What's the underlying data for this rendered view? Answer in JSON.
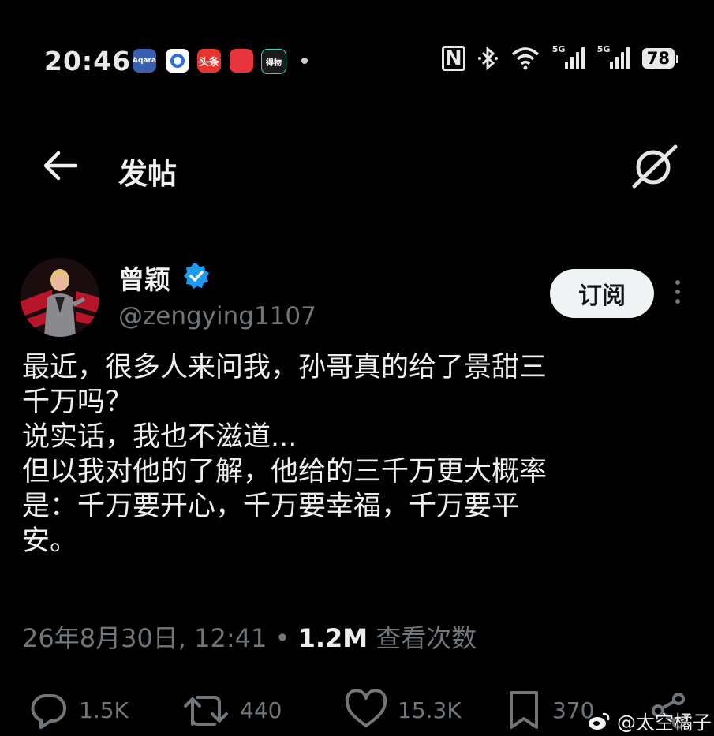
{
  "status_bar": {
    "time": "20:46",
    "apps": [
      {
        "icon": "aqara-app-icon",
        "label": "Aqara",
        "color": "#3a5fb0"
      },
      {
        "icon": "circle-app-icon",
        "label": "",
        "color": "#ffffff"
      },
      {
        "icon": "toutiao-app-icon",
        "label": "头条",
        "color": "#e8342e"
      },
      {
        "icon": "red-app-icon",
        "label": "",
        "color": "#e8343b"
      },
      {
        "icon": "dewu-app-icon",
        "label": "得物",
        "color": "#1a1a1a"
      }
    ],
    "network_1": "5G",
    "network_2": "5G",
    "battery": "78"
  },
  "header": {
    "title": "发帖"
  },
  "author": {
    "name": "曾颖",
    "handle": "@zengying1107",
    "subscribe_label": "订阅"
  },
  "post": {
    "lines": [
      "最近，很多人来问我，孙哥真的给了景甜三",
      "千万吗？",
      "说实话，我也不滋道...",
      "但以我对他的了解，他给的三千万更大概率",
      "是：千万要开心，千万要幸福，千万要平",
      "安。"
    ],
    "timestamp": "26年8月30日, 12:41",
    "separator": "•",
    "views": "1.2M",
    "views_label": "查看次数"
  },
  "actions": {
    "replies": "1.5K",
    "reposts": "440",
    "likes": "15.3K",
    "bookmarks": "370"
  },
  "watermark": "@太空橘子",
  "colors": {
    "background": "#000000",
    "text": "#e7e9ea",
    "muted": "#71767b",
    "verified": "#1d9bf0"
  }
}
